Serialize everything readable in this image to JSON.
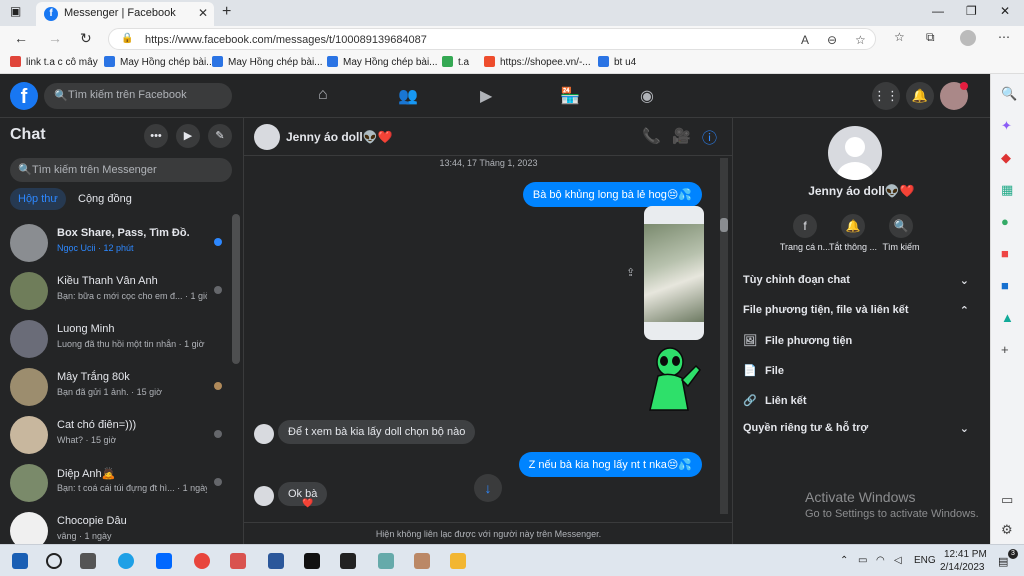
{
  "browser": {
    "tab_title": "Messenger | Facebook",
    "tab_favicon": "f",
    "url": "https://www.facebook.com/messages/t/100089139684087",
    "bookmarks": [
      {
        "label": "link t.a c cô mây",
        "color": "#e0453a"
      },
      {
        "label": "May Hồng chép bài...",
        "color": "#2b74e4"
      },
      {
        "label": "May Hồng chép bài...",
        "color": "#2b74e4"
      },
      {
        "label": "May Hồng chép bài...",
        "color": "#2b74e4"
      },
      {
        "label": "t.a",
        "color": "#34a853"
      },
      {
        "label": "https://shopee.vn/-...",
        "color": "#ee4d2d"
      },
      {
        "label": "bt u4",
        "color": "#2b74e4"
      }
    ]
  },
  "facebook": {
    "search_placeholder": "Tìm kiếm trên Facebook",
    "logo_letter": "f"
  },
  "chats": {
    "title": "Chat",
    "search_placeholder": "Tìm kiếm trên Messenger",
    "tabs": [
      "Hộp thư",
      "Cộng đồng"
    ],
    "items": [
      {
        "name": "Box Share, Pass, Tìm Đồ.",
        "sub": "Ngọc Ucii · 12 phút",
        "bold": true,
        "avatar": "#8a8d91",
        "status": "#2d88ff"
      },
      {
        "name": "Kiều Thanh Vân Anh",
        "sub": "Bạn: bữa c mới cọc cho em đ... · 1 giờ",
        "bold": false,
        "avatar": "#6f7d5a",
        "status": "#65676b"
      },
      {
        "name": "Luong Minh",
        "sub": "Luong đã thu hồi một tin nhắn · 1 giờ",
        "bold": false,
        "avatar": "#6a6c78",
        "status": ""
      },
      {
        "name": "Mây Trắng 80k",
        "sub": "Bạn đã gửi 1 ảnh. · 15 giờ",
        "bold": false,
        "avatar": "#9c8d6e",
        "status": "#b08a5a"
      },
      {
        "name": "Cat chó điên=)))",
        "sub": "What? · 15 giờ",
        "bold": false,
        "avatar": "#c8b79e",
        "status": "#65676b"
      },
      {
        "name": "Diệp Anh🙇",
        "sub": "Bạn: t coá cái túi đựng đt hì... · 1 ngày",
        "bold": false,
        "avatar": "#7a8a6a",
        "status": "#65676b"
      },
      {
        "name": "Chocopie Dâu",
        "sub": "vâng · 1 ngày",
        "bold": false,
        "avatar": "#f0f0f0",
        "status": ""
      }
    ]
  },
  "conversation": {
    "contact_name": "Jenny áo doll👽❤️",
    "timestamp": "13:44, 17 Tháng 1, 2023",
    "messages": [
      {
        "dir": "out",
        "text": "Bà bộ khủng long bà lẻ hog😔💦"
      },
      {
        "dir": "in",
        "text": "Để t xem bà kia lấy doll chọn bộ nào"
      },
      {
        "dir": "out",
        "text": "Z nếu bà kia hog lấy nt t nka😔💦"
      },
      {
        "dir": "in",
        "text": "Ok bà"
      }
    ],
    "reaction": "❤️",
    "footer": "Hiện không liên lạc được với người này trên Messenger."
  },
  "info_panel": {
    "name": "Jenny áo doll👽❤️",
    "actions": [
      "Trang cá n...",
      "Tắt thông ...",
      "Tìm kiếm"
    ],
    "sections": {
      "customize": "Tùy chỉnh đoạn chat",
      "media": "File phương tiện, file và liên kết",
      "media_items": [
        "File phương tiện",
        "File",
        "Liên kết"
      ],
      "privacy": "Quyền riêng tư & hỗ trợ"
    }
  },
  "watermark": {
    "line1": "Activate Windows",
    "line2": "Go to Settings to activate Windows."
  },
  "taskbar": {
    "lang": "ENG",
    "time": "12:41 PM",
    "date": "2/14/2023",
    "notif": "3"
  }
}
